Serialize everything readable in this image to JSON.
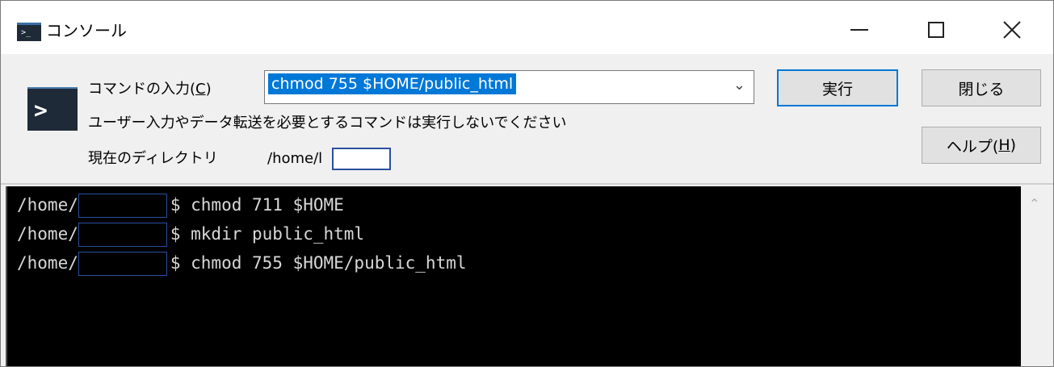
{
  "window": {
    "title": "コンソール",
    "icon": "console-icon",
    "controls": {
      "minimize": "minimize-icon",
      "maximize": "maximize-icon",
      "close": "close-icon"
    }
  },
  "command": {
    "label_prefix": "コマンドの入力(",
    "label_key": "C",
    "label_suffix": ")",
    "value": "chmod 755 $HOME/public_html",
    "warning": "ユーザー入力やデータ転送を必要とするコマンドは実行しないでください",
    "cwd_label": "現在のディレクトリ",
    "cwd_value": "/home/l",
    "icon": "terminal-prompt-icon"
  },
  "buttons": {
    "run": "実行",
    "close": "閉じる",
    "help_prefix": "ヘルプ(",
    "help_key": "H",
    "help_suffix": ")"
  },
  "terminal": {
    "lines": [
      {
        "prefix": "/home/",
        "command": "$ chmod 711 $HOME"
      },
      {
        "prefix": "/home/",
        "command": "$ mkdir public_html"
      },
      {
        "prefix": "/home/",
        "command": "$ chmod 755 $HOME/public_html"
      }
    ]
  },
  "colors": {
    "selection": "#0078d7",
    "terminal_bg": "#000000",
    "terminal_fg": "#d8d8d8",
    "mask_border": "#2c4f9e"
  }
}
